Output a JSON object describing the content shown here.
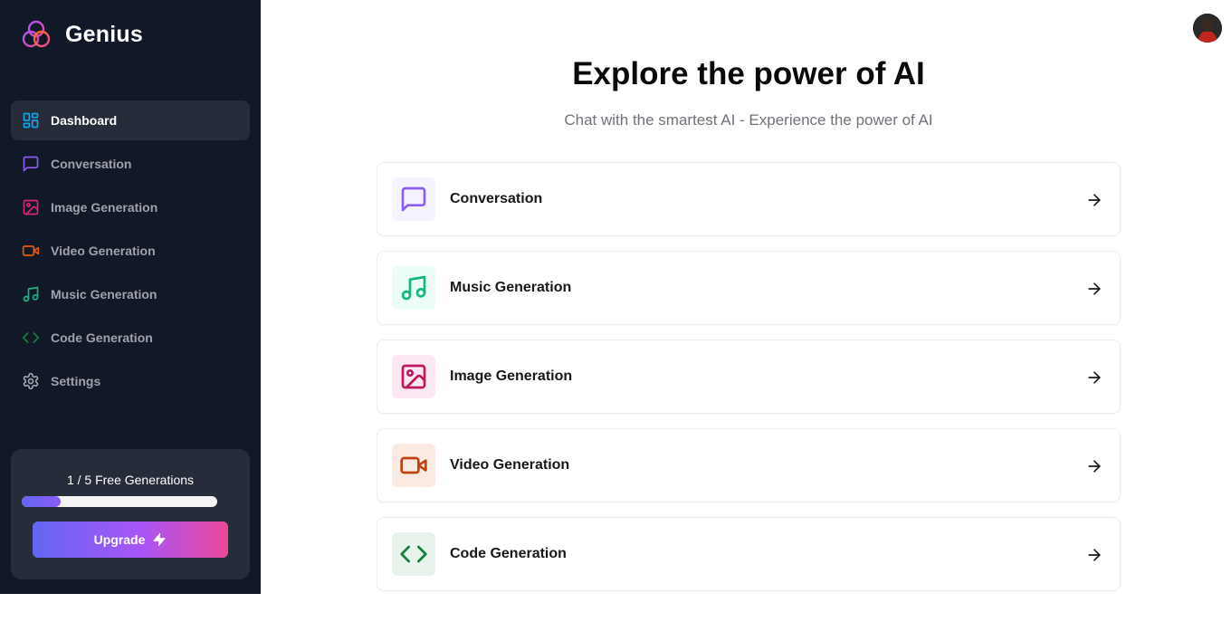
{
  "app": {
    "name": "Genius"
  },
  "sidebar": {
    "items": [
      {
        "label": "Dashboard",
        "icon": "layout-dashboard-icon",
        "color": "#0ea5e9",
        "active": true
      },
      {
        "label": "Conversation",
        "icon": "message-square-icon",
        "color": "#8b5cf6"
      },
      {
        "label": "Image Generation",
        "icon": "image-icon",
        "color": "#db2777"
      },
      {
        "label": "Video Generation",
        "icon": "video-icon",
        "color": "#ea580c"
      },
      {
        "label": "Music Generation",
        "icon": "music-icon",
        "color": "#10b981"
      },
      {
        "label": "Code Generation",
        "icon": "code-icon",
        "color": "#15803d"
      },
      {
        "label": "Settings",
        "icon": "settings-icon",
        "color": "#a1a1aa"
      }
    ]
  },
  "usage": {
    "text": "1 / 5 Free Generations",
    "used": 1,
    "limit": 5,
    "upgrade_label": "Upgrade"
  },
  "main": {
    "title": "Explore the power of AI",
    "subtitle": "Chat with the smartest AI - Experience the power of AI"
  },
  "tools": [
    {
      "label": "Conversation",
      "icon": "message-square-icon",
      "color": "#8b5cf6",
      "bg": "#f5f3ff"
    },
    {
      "label": "Music Generation",
      "icon": "music-icon",
      "color": "#10b981",
      "bg": "#ecfdf5"
    },
    {
      "label": "Image Generation",
      "icon": "image-icon",
      "color": "#be185d",
      "bg": "#fce7f3"
    },
    {
      "label": "Video Generation",
      "icon": "video-icon",
      "color": "#c2410c",
      "bg": "#fbeae2"
    },
    {
      "label": "Code Generation",
      "icon": "code-icon",
      "color": "#15803d",
      "bg": "#e8f3ec"
    }
  ]
}
